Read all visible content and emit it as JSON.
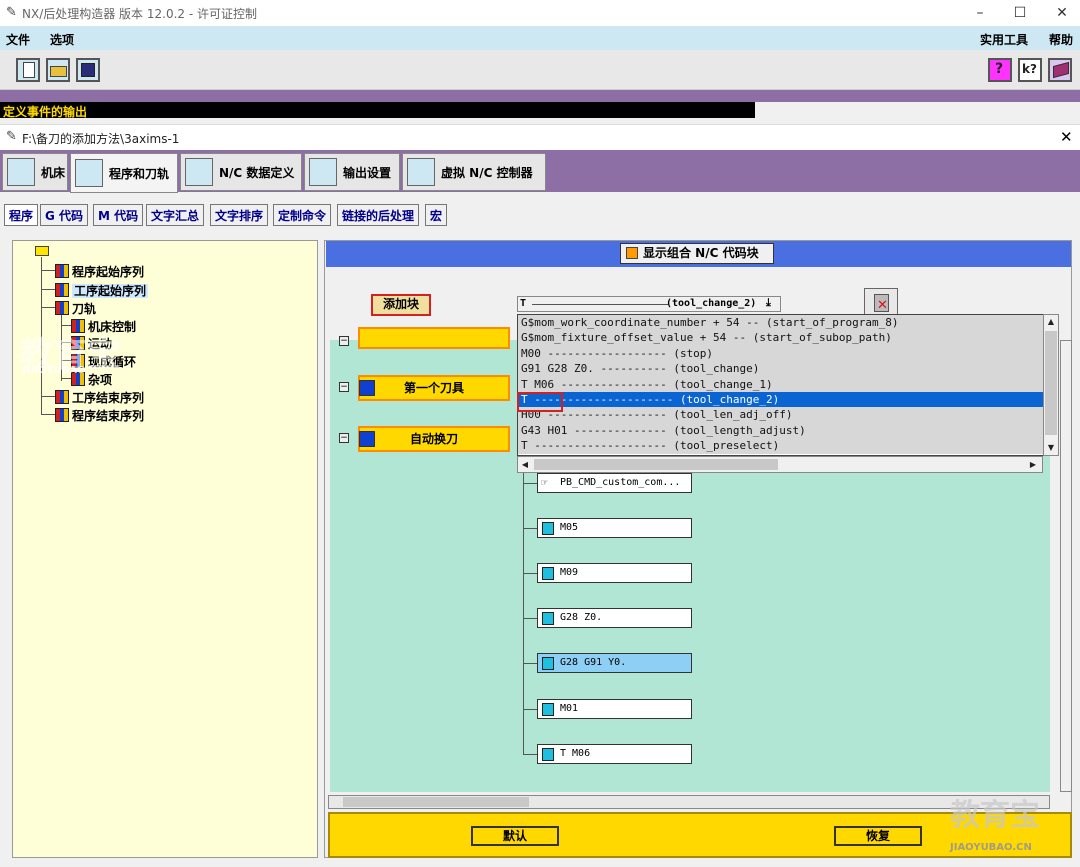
{
  "window": {
    "title": "NX/后处理构造器 版本 12.0.2 - 许可证控制",
    "minimize": "–",
    "maximize": "☐",
    "close": "✕"
  },
  "menubar": {
    "file": "文件",
    "options": "选项",
    "utilities": "实用工具",
    "help": "帮助"
  },
  "toolbar": {
    "help_icons": [
      "?",
      "k?"
    ]
  },
  "event_output_label": "定义事件的输出",
  "dialog": {
    "title": "F:\\备刀的添加方法\\3axims-1",
    "close": "✕"
  },
  "main_tabs": [
    {
      "label": "机床"
    },
    {
      "label": "程序和刀轨"
    },
    {
      "label": "N/C 数据定义"
    },
    {
      "label": "输出设置"
    },
    {
      "label": "虚拟 N/C 控制器"
    }
  ],
  "sub_tabs": [
    "程序",
    "G 代码",
    "M 代码",
    "文字汇总",
    "文字排序",
    "定制命令",
    "链接的后处理",
    "宏"
  ],
  "tree": {
    "items": [
      {
        "label": "程序起始序列",
        "level": 1
      },
      {
        "label": "工序起始序列",
        "level": 1,
        "selected": true
      },
      {
        "label": "刀轨",
        "level": 1
      },
      {
        "label": "机床控制",
        "level": 2
      },
      {
        "label": "运动",
        "level": 2
      },
      {
        "label": "现成循环",
        "level": 2
      },
      {
        "label": "杂项",
        "level": 2
      },
      {
        "label": "工序结束序列",
        "level": 1
      },
      {
        "label": "程序结束序列",
        "level": 1
      }
    ]
  },
  "right_panel": {
    "show_combined_label": "显示组合 N/C 代码块",
    "add_block_label": "添加块",
    "combo": {
      "prefix": "T",
      "value": "(tool_change_2)"
    },
    "dropdown_items": [
      "G$mom_work_coordinate_number + 54 -- (start_of_program_8)",
      "G$mom_fixture_offset_value + 54 -- (start_of_subop_path)",
      "M00 ------------------ (stop)",
      "G91 G28 Z0. ---------- (tool_change)",
      "T M06 ---------------- (tool_change_1)",
      "T --------------------- (tool_change_2)",
      "H00 ------------------ (tool_len_adj_off)",
      "G43 H01 -------------- (tool_length_adjust)",
      "T -------------------- (tool_preselect)"
    ],
    "selected_index": 5,
    "event_blocks": [
      "第一个刀具",
      "自动换刀"
    ],
    "nc_blocks": [
      {
        "text": "PB_CMD_custom_com...",
        "selected": false
      },
      {
        "text": "M05",
        "selected": false
      },
      {
        "text": "M09",
        "selected": false
      },
      {
        "text": "G28 Z0.",
        "selected": false
      },
      {
        "text": "G28 G91 Y0.",
        "selected": true
      },
      {
        "text": "M01",
        "selected": false
      },
      {
        "text": "T M06",
        "selected": false
      }
    ],
    "default_button": "默认",
    "restore_button": "恢复"
  },
  "watermark": {
    "text": "教育宝",
    "subtext": "JIAOYUBAO",
    "bottom_sub": "JIAOYUBAO.CN"
  },
  "colors": {
    "tree_bg": "#ffffd7",
    "canvas_bg": "#b0e6d3",
    "accent_blue": "#4a6fe0",
    "selection_blue": "#0a64d2",
    "event_yellow": "#ffd800",
    "band_purple": "#8d6fa6"
  }
}
